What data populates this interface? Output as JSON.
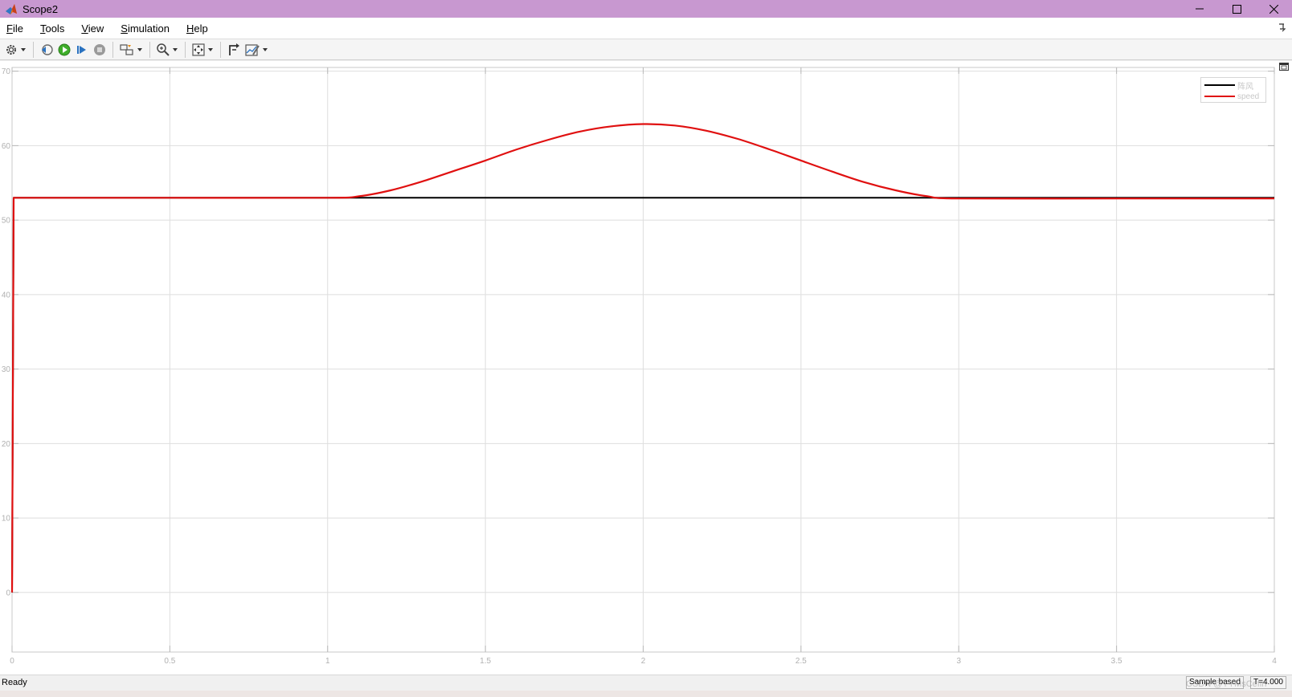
{
  "window": {
    "title": "Scope2",
    "title_bar_color": "#c898d0"
  },
  "menu": {
    "items": [
      {
        "label": "File",
        "mnemonic": "F",
        "rest": "ile"
      },
      {
        "label": "Tools",
        "mnemonic": "T",
        "rest": "ools"
      },
      {
        "label": "View",
        "mnemonic": "V",
        "rest": "iew"
      },
      {
        "label": "Simulation",
        "mnemonic": "S",
        "rest": "imulation"
      },
      {
        "label": "Help",
        "mnemonic": "H",
        "rest": "elp"
      }
    ]
  },
  "toolbar": {
    "buttons": [
      "settings-icon",
      "step-back-icon",
      "run-icon",
      "step-forward-icon",
      "stop-icon",
      "highlight-block-icon",
      "zoom-icon",
      "fit-to-view-icon",
      "write-data-icon",
      "style-icon"
    ]
  },
  "chart_data": {
    "type": "line",
    "xlim": [
      0,
      4
    ],
    "ylim": [
      -8,
      70.5
    ],
    "x_ticks": [
      0,
      0.5,
      1,
      1.5,
      2,
      2.5,
      3,
      3.5,
      4
    ],
    "x_tick_labels": [
      "0",
      "0.5",
      "1",
      "1.5",
      "2",
      "2.5",
      "3",
      "3.5",
      "4"
    ],
    "y_ticks": [
      0,
      10,
      20,
      30,
      40,
      50,
      60,
      70
    ],
    "y_tick_labels": [
      "0",
      "10",
      "20",
      "30",
      "40",
      "50",
      "60",
      "70"
    ],
    "grid": true,
    "legend_position": "top-right",
    "series": [
      {
        "name": "阵风",
        "color": "#000000",
        "x": [
          0,
          0.005,
          1.0,
          4.0
        ],
        "y": [
          0,
          53.0,
          53.0,
          53.0
        ]
      },
      {
        "name": "speed",
        "color": "#e01010",
        "x": [
          0,
          0.005,
          0.5,
          1.0,
          1.1,
          1.2,
          1.3,
          1.4,
          1.5,
          1.6,
          1.7,
          1.8,
          1.9,
          2.0,
          2.1,
          2.2,
          2.3,
          2.4,
          2.5,
          2.6,
          2.7,
          2.8,
          2.9,
          3.0,
          3.5,
          4.0
        ],
        "y": [
          0,
          53.0,
          53.0,
          53.0,
          53.2,
          54.0,
          55.2,
          56.6,
          58.0,
          59.5,
          60.8,
          61.9,
          62.6,
          62.9,
          62.7,
          62.0,
          60.9,
          59.5,
          58.0,
          56.5,
          55.1,
          54.0,
          53.2,
          52.9,
          52.9,
          52.9
        ]
      }
    ]
  },
  "status": {
    "left": "Ready",
    "sample_mode": "Sample based",
    "time": "T=4.000"
  },
  "watermark": "CSDN @YYMsCefin"
}
